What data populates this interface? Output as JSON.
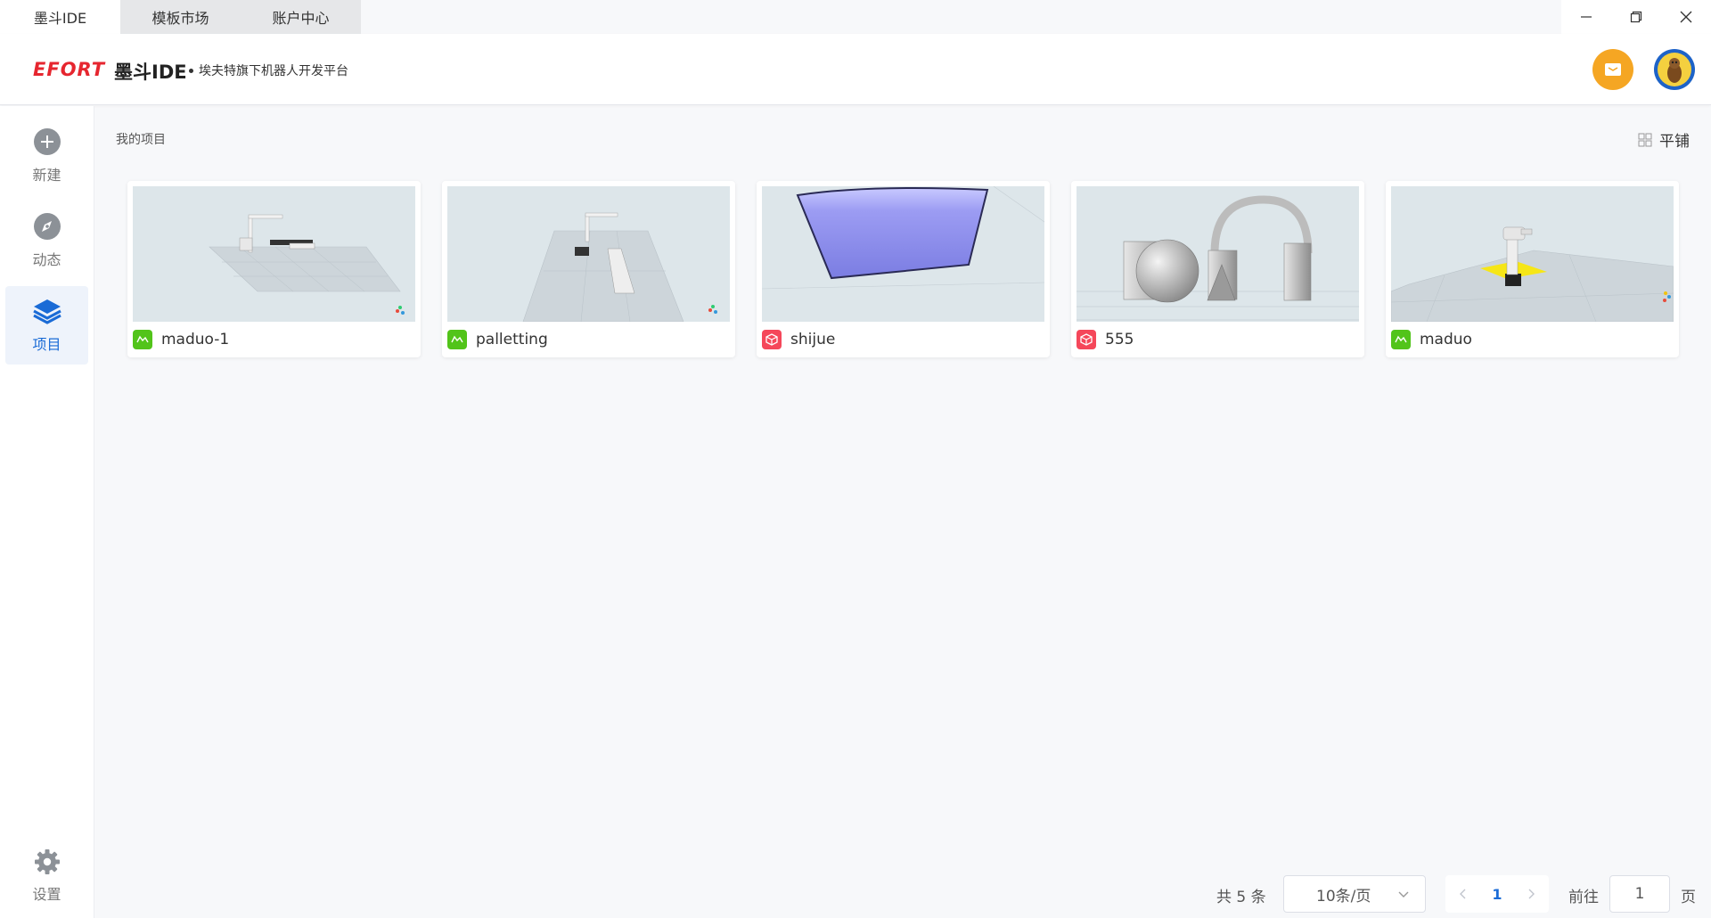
{
  "titlebar": {
    "tabs": [
      {
        "label": "墨斗IDE"
      },
      {
        "label": "模板市场"
      },
      {
        "label": "账户中心"
      }
    ]
  },
  "header": {
    "logo": "EFORT",
    "app_name": "墨斗IDE",
    "subtitle": "埃夫特旗下机器人开发平台"
  },
  "sidebar": {
    "items": [
      {
        "label": "新建",
        "icon": "plus-circle-icon"
      },
      {
        "label": "动态",
        "icon": "compass-icon"
      },
      {
        "label": "项目",
        "icon": "layers-icon"
      },
      {
        "label": "设置",
        "icon": "gear-icon"
      }
    ]
  },
  "main": {
    "section_title": "我的项目",
    "view_toggle_label": "平铺",
    "projects": [
      {
        "name": "maduo-1",
        "type_color": "#52c41a"
      },
      {
        "name": "palletting",
        "type_color": "#52c41a"
      },
      {
        "name": "shijue",
        "type_color": "#f5475a"
      },
      {
        "name": "555",
        "type_color": "#f5475a"
      },
      {
        "name": "maduo",
        "type_color": "#52c41a"
      }
    ]
  },
  "pagination": {
    "total": "共 5 条",
    "page_size": "10条/页",
    "current_page": "1",
    "goto_label": "前往",
    "goto_value": "1",
    "page_unit": "页"
  },
  "colors": {
    "accent": "#1a6bd6",
    "logo_red": "#e6262f",
    "message_orange": "#f5a623"
  }
}
